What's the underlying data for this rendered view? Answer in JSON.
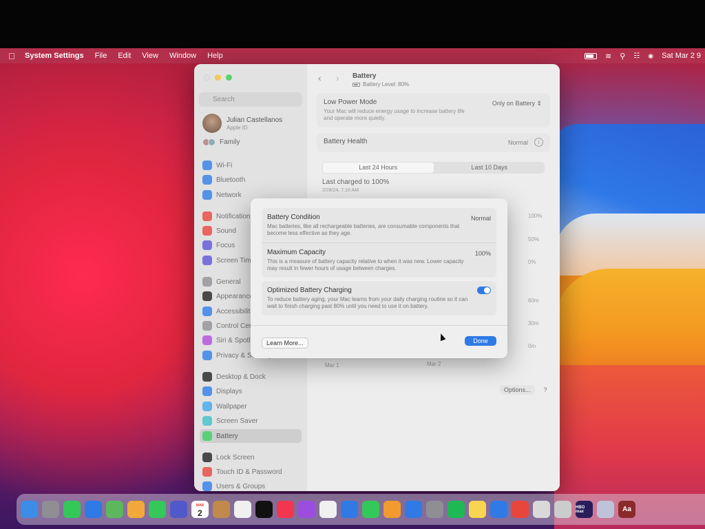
{
  "menubar": {
    "apple": "",
    "items": [
      "System Settings",
      "File",
      "Edit",
      "View",
      "Window",
      "Help"
    ],
    "clock": "Sat Mar 2  9"
  },
  "sidebar": {
    "search_placeholder": "Search",
    "account": {
      "name": "Julian Castellanos",
      "subtitle": "Apple ID"
    },
    "family": "Family",
    "items": [
      {
        "label": "Wi-Fi",
        "icon": "wifi-icon",
        "color": "#2f7ae5"
      },
      {
        "label": "Bluetooth",
        "icon": "bluetooth-icon",
        "color": "#2f7ae5"
      },
      {
        "label": "Network",
        "icon": "globe-icon",
        "color": "#2f7ae5"
      },
      {
        "label": "Notifications",
        "icon": "bell-icon",
        "color": "#e5443a"
      },
      {
        "label": "Sound",
        "icon": "speaker-icon",
        "color": "#e5443a"
      },
      {
        "label": "Focus",
        "icon": "moon-icon",
        "color": "#5a55d6"
      },
      {
        "label": "Screen Time",
        "icon": "hourglass-icon",
        "color": "#5a55d6"
      },
      {
        "label": "General",
        "icon": "gear-icon",
        "color": "#8e8e93"
      },
      {
        "label": "Appearance",
        "icon": "appearance-icon",
        "color": "#222222"
      },
      {
        "label": "Accessibility",
        "icon": "accessibility-icon",
        "color": "#2f7ae5"
      },
      {
        "label": "Control Centre",
        "icon": "control-center-icon",
        "color": "#8e8e93"
      },
      {
        "label": "Siri & Spotlight",
        "icon": "siri-icon",
        "color": "#b04ad8"
      },
      {
        "label": "Privacy & Security",
        "icon": "hand-icon",
        "color": "#2f7ae5"
      },
      {
        "label": "Desktop & Dock",
        "icon": "dock-icon",
        "color": "#222222"
      },
      {
        "label": "Displays",
        "icon": "sun-icon",
        "color": "#2f7ae5"
      },
      {
        "label": "Wallpaper",
        "icon": "wallpaper-icon",
        "color": "#3fa4e8"
      },
      {
        "label": "Screen Saver",
        "icon": "screensaver-icon",
        "color": "#3fbcc8"
      },
      {
        "label": "Battery",
        "icon": "battery-icon",
        "color": "#34c759"
      },
      {
        "label": "Lock Screen",
        "icon": "lock-icon",
        "color": "#222222"
      },
      {
        "label": "Touch ID & Password",
        "icon": "fingerprint-icon",
        "color": "#e5443a"
      },
      {
        "label": "Users & Groups",
        "icon": "users-icon",
        "color": "#2f7ae5"
      }
    ]
  },
  "pane": {
    "title": "Battery",
    "subtitle": "Battery Level: 80%",
    "low_power": {
      "title": "Low Power Mode",
      "desc": "Your Mac will reduce energy usage to increase battery life and operate more quietly.",
      "value": "Only on Battery ⇕"
    },
    "health": {
      "title": "Battery Health",
      "value": "Normal"
    },
    "tabs": [
      "Last 24 Hours",
      "Last 10 Days"
    ],
    "last_charged": "Last charged to 100%",
    "last_charged_date": "2/28/24, 7:16 AM",
    "chart_labels": {
      "y_top": [
        "100%",
        "50%",
        "0%"
      ],
      "y_bottom": [
        "60m",
        "30m",
        "0m"
      ],
      "x": [
        "Mar 1",
        "Mar 2"
      ]
    },
    "options_button": "Options...",
    "help_button": "?"
  },
  "modal": {
    "rows": [
      {
        "title": "Battery Condition",
        "desc": "Mac batteries, like all rechargeable batteries, are consumable components that become less effective as they age.",
        "value": "Normal"
      },
      {
        "title": "Maximum Capacity",
        "desc": "This is a measure of battery capacity relative to when it was new. Lower capacity may result in fewer hours of usage between charges.",
        "value": "100%"
      }
    ],
    "optimized": {
      "title": "Optimized Battery Charging",
      "desc": "To reduce battery aging, your Mac learns from your daily charging routine so it can wait to finish charging past 80% until you need to use it on battery.",
      "enabled": true
    },
    "learn_more": "Learn More...",
    "done": "Done"
  },
  "dock": {
    "apps": [
      {
        "name": "finder-icon",
        "color": "#3b8de8"
      },
      {
        "name": "launchpad-icon",
        "color": "#8e8e93"
      },
      {
        "name": "messages-icon",
        "color": "#34c759"
      },
      {
        "name": "mail-icon",
        "color": "#2f7ae5"
      },
      {
        "name": "maps-icon",
        "color": "#5bb85d"
      },
      {
        "name": "photos-icon",
        "color": "#f2a83b"
      },
      {
        "name": "facetime-icon",
        "color": "#34c759"
      },
      {
        "name": "teams-icon",
        "color": "#5059c9"
      },
      {
        "name": "calendar-icon",
        "color": "#ffffff"
      },
      {
        "name": "contacts-icon",
        "color": "#c18a4a"
      },
      {
        "name": "reminders-icon",
        "color": "#f0f0f0"
      },
      {
        "name": "apple-tv-icon",
        "color": "#111111"
      },
      {
        "name": "music-icon",
        "color": "#f2364f"
      },
      {
        "name": "podcasts-icon",
        "color": "#9b4de0"
      },
      {
        "name": "news-icon",
        "color": "#f0f0f0"
      },
      {
        "name": "keynote-icon",
        "color": "#2f7ae5"
      },
      {
        "name": "numbers-icon",
        "color": "#34c759"
      },
      {
        "name": "pages-icon",
        "color": "#f29a2e"
      },
      {
        "name": "app-store-icon",
        "color": "#2f7ae5"
      },
      {
        "name": "system-settings-icon",
        "color": "#8e8e93"
      },
      {
        "name": "spotify-icon",
        "color": "#1db954"
      },
      {
        "name": "notes-icon",
        "color": "#f7d550"
      },
      {
        "name": "safari-icon",
        "color": "#2f7ae5"
      },
      {
        "name": "chrome-icon",
        "color": "#e8453c"
      },
      {
        "name": "preview-icon",
        "color": "#d9d9d9"
      },
      {
        "name": "roblox-icon",
        "color": "#cccccc"
      },
      {
        "name": "hbo-max-icon",
        "color": "#2a1d5c"
      },
      {
        "name": "cube-app-icon",
        "color": "#bfc3d9"
      },
      {
        "name": "dictionary-icon",
        "color": "#8b2a2a"
      }
    ],
    "calendar": {
      "month": "MAR",
      "day": "2"
    },
    "hbo_label": "HBO max",
    "dictionary_label": "Aa"
  }
}
